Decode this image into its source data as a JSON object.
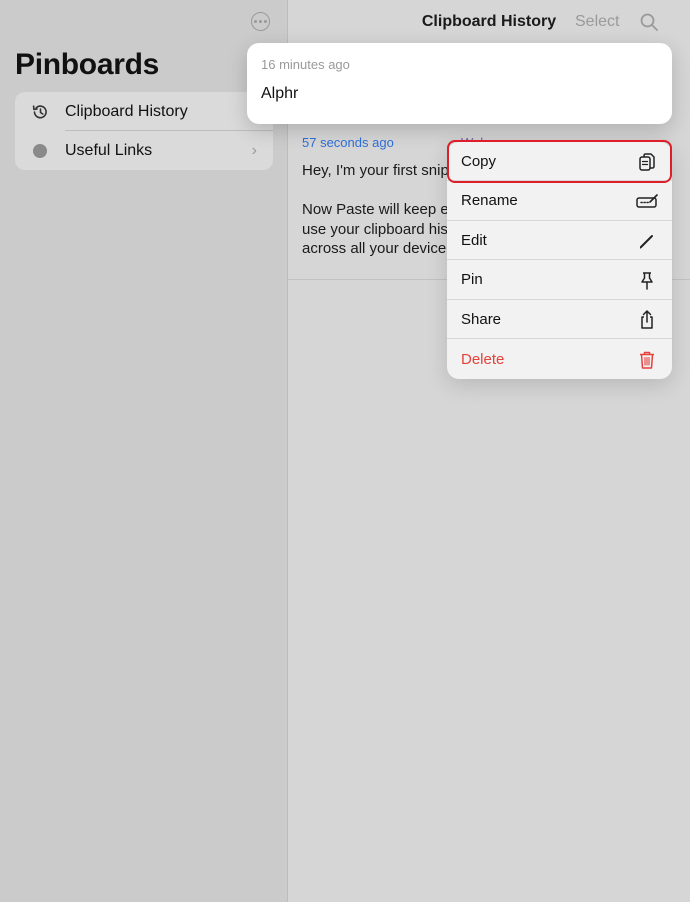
{
  "sidebar": {
    "title": "Pinboards",
    "items": [
      {
        "label": "Clipboard History",
        "icon": "history-icon"
      },
      {
        "label": "Useful Links",
        "icon": "dot-icon"
      }
    ]
  },
  "header": {
    "title": "Clipboard History",
    "select_label": "Select"
  },
  "clip_item": {
    "time": "57 seconds ago",
    "tag": "Welcome",
    "lines": [
      "Hey, I'm your first snip",
      "Now Paste will keep e",
      "use your clipboard his",
      "across all your device"
    ]
  },
  "preview": {
    "time": "16 minutes ago",
    "text": "Alphr"
  },
  "context_menu": {
    "items": [
      {
        "label": "Copy",
        "icon": "copy-icon"
      },
      {
        "label": "Rename",
        "icon": "rename-icon"
      },
      {
        "label": "Edit",
        "icon": "pencil-icon"
      },
      {
        "label": "Pin",
        "icon": "pin-icon"
      },
      {
        "label": "Share",
        "icon": "share-icon"
      },
      {
        "label": "Delete",
        "icon": "trash-icon"
      }
    ]
  },
  "colors": {
    "accent_blue": "#2e6fd8",
    "delete_red": "#e5413b",
    "highlight_red": "#de1f2a"
  }
}
